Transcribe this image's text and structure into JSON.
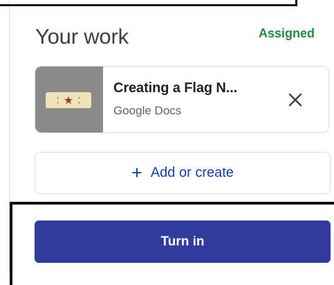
{
  "card": {
    "title": "Your work",
    "status": "Assigned",
    "status_color": "#1e8e3e"
  },
  "attachment": {
    "name": "Creating a Flag N...",
    "type": "Google Docs",
    "thumbnail_icon": "flag-thumbnail",
    "remove_icon": "close-icon"
  },
  "actions": {
    "add_label": "Add or create",
    "add_icon": "plus-icon",
    "turn_in_label": "Turn in",
    "turn_in_color": "#2f3c9e",
    "accent_color": "#1a3fa8"
  }
}
